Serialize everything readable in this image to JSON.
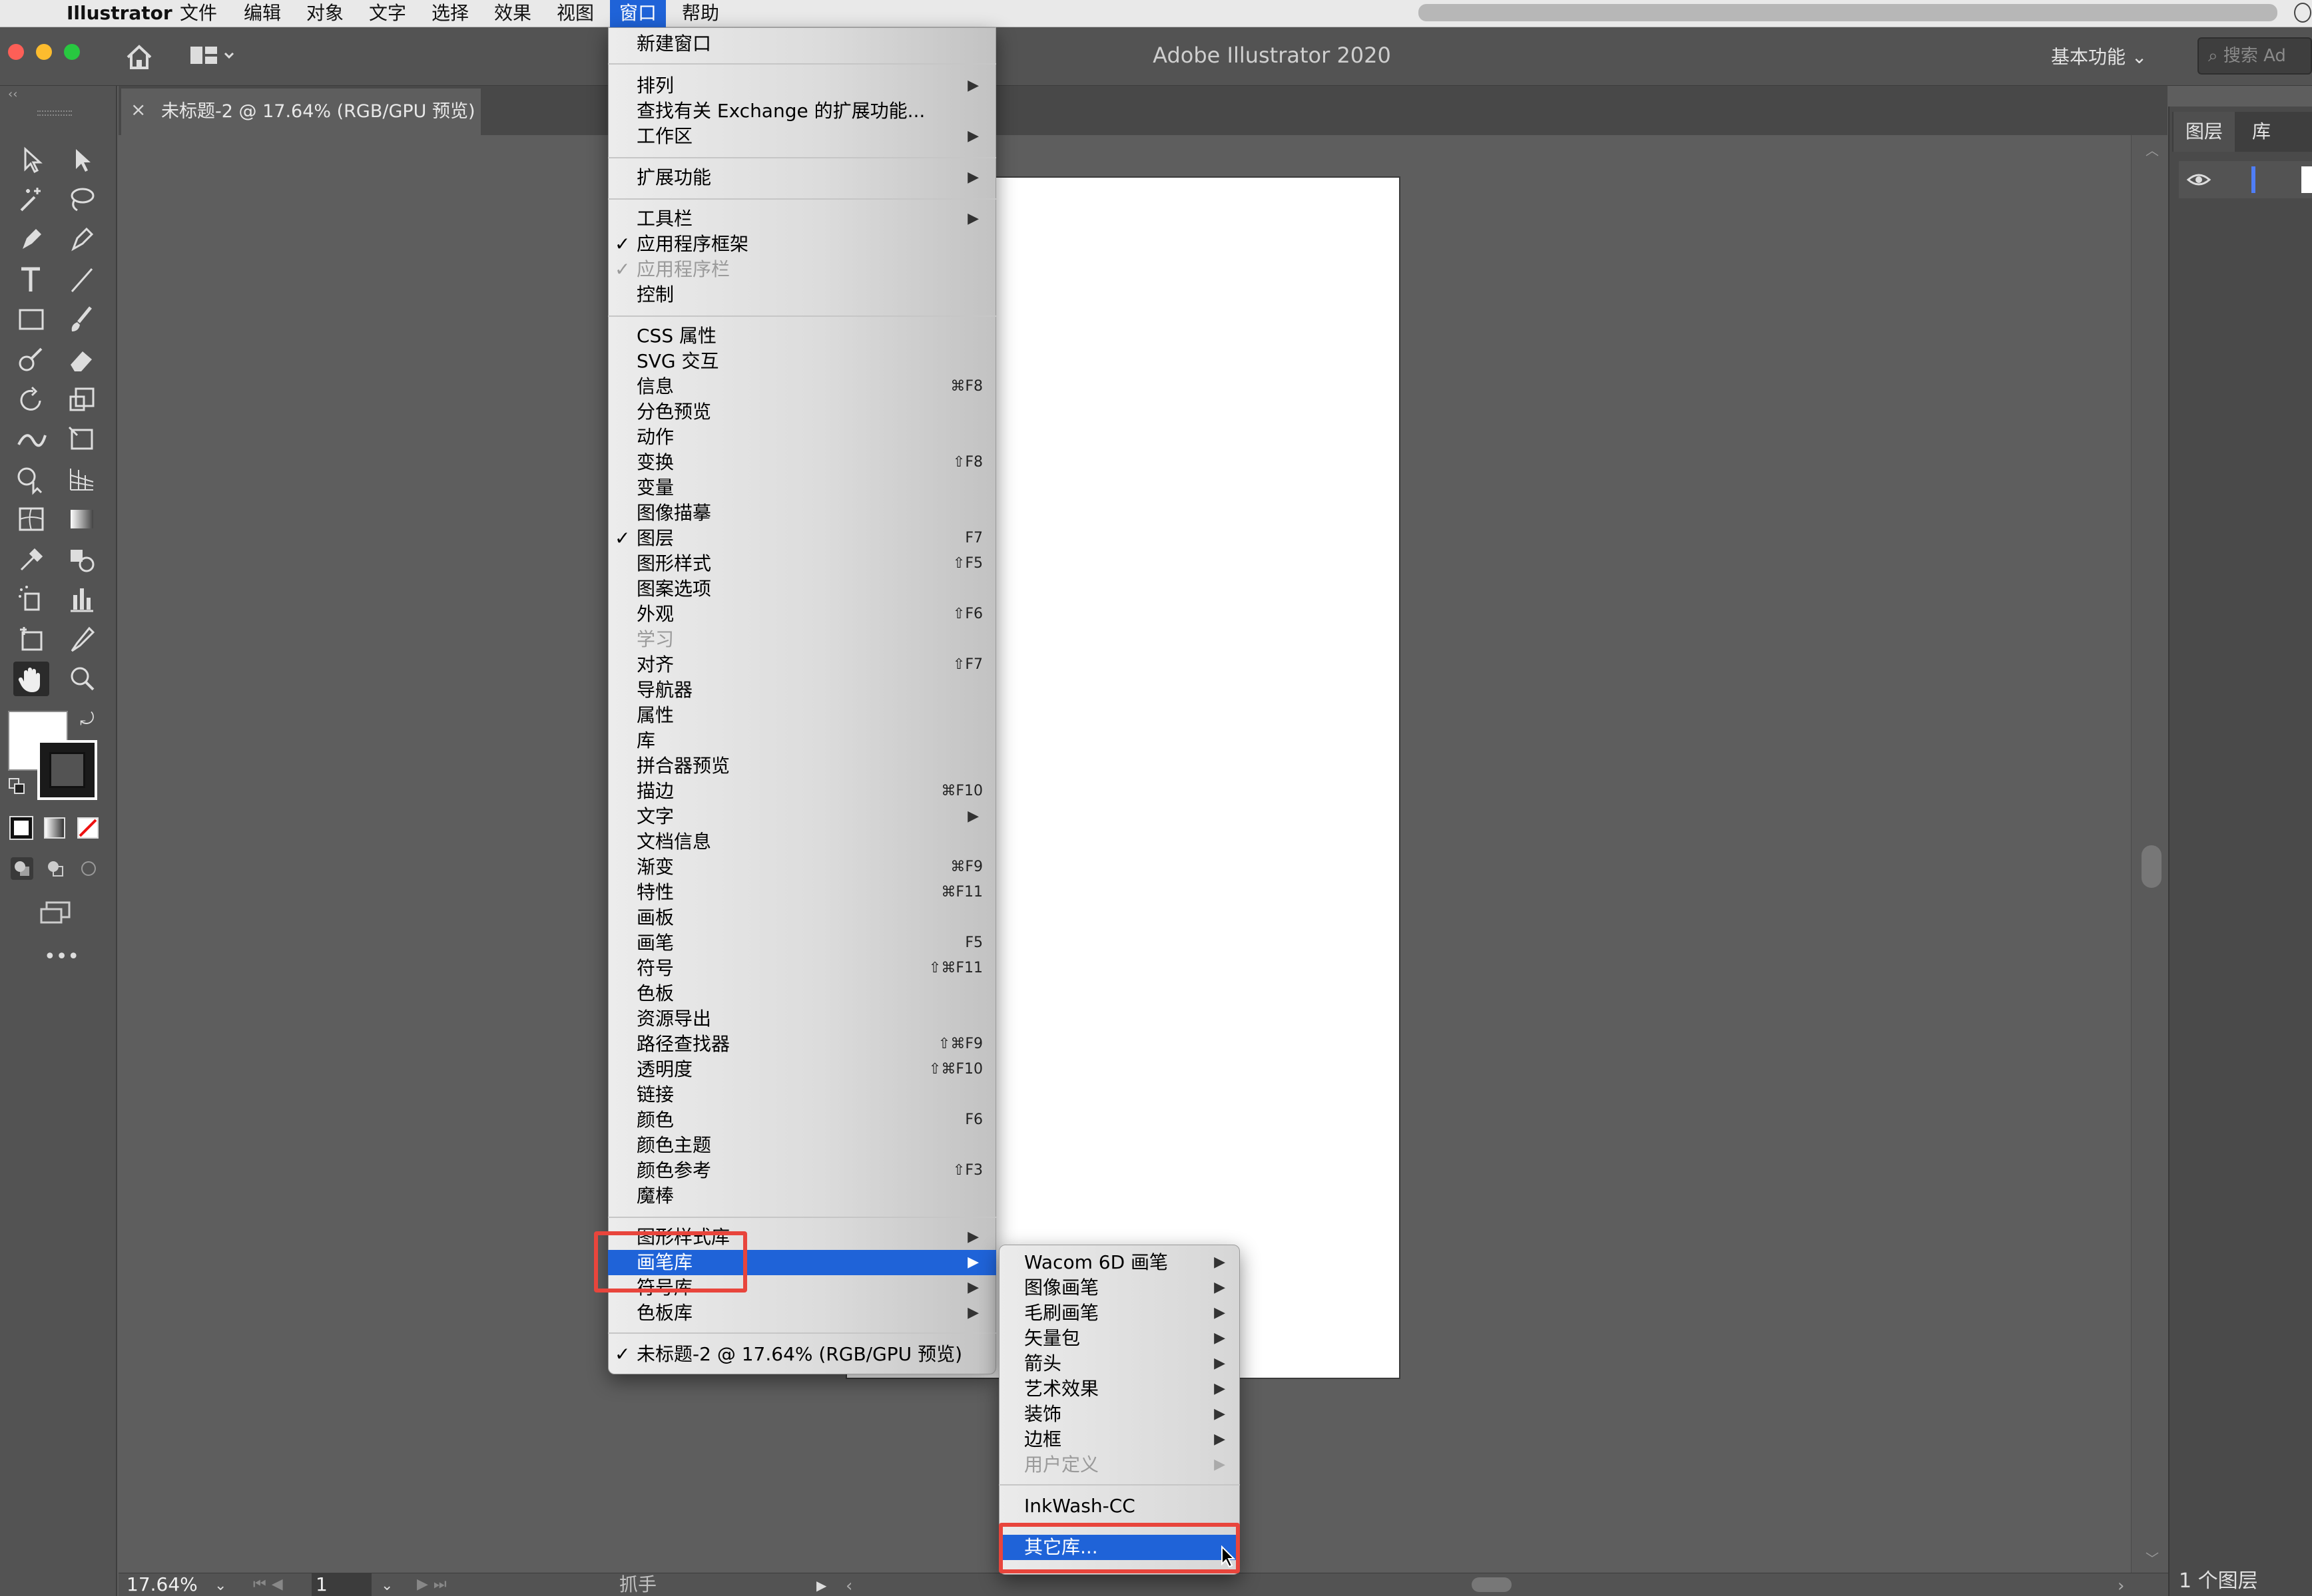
{
  "menubar": {
    "app_name": "Illustrator",
    "items": [
      "文件",
      "编辑",
      "对象",
      "文字",
      "选择",
      "效果",
      "视图",
      "窗口",
      "帮助"
    ],
    "active_item": "窗口"
  },
  "appbar": {
    "title": "Adobe Illustrator 2020",
    "workspace": "基本功能",
    "search_placeholder": "搜索 Ad"
  },
  "document_tab": {
    "title": "未标题-2 @ 17.64% (RGB/GPU 预览)",
    "close": "×"
  },
  "right_panel": {
    "tabs": [
      "图层",
      "库"
    ],
    "layers_count": "1 个图层",
    "eye": "👁"
  },
  "bottom_bar": {
    "zoom": "17.64%",
    "page": "1",
    "status": "抓手"
  },
  "window_menu": {
    "items": [
      {
        "label": "新建窗口"
      },
      {
        "label": "排列",
        "submenu": true
      },
      {
        "label": "查找有关 Exchange 的扩展功能..."
      },
      {
        "label": "工作区",
        "submenu": true
      },
      {
        "label": "扩展功能",
        "submenu": true
      },
      {
        "label": "工具栏",
        "submenu": true
      },
      {
        "label": "应用程序框架",
        "checked": true
      },
      {
        "label": "应用程序栏",
        "checked": true,
        "disabled": true
      },
      {
        "label": "控制"
      },
      {
        "label": "CSS 属性"
      },
      {
        "label": "SVG 交互"
      },
      {
        "label": "信息",
        "shortcut": "⌘F8"
      },
      {
        "label": "分色预览"
      },
      {
        "label": "动作"
      },
      {
        "label": "变换",
        "shortcut": "⇧F8"
      },
      {
        "label": "变量"
      },
      {
        "label": "图像描摹"
      },
      {
        "label": "图层",
        "checked": true,
        "shortcut": "F7"
      },
      {
        "label": "图形样式",
        "shortcut": "⇧F5"
      },
      {
        "label": "图案选项"
      },
      {
        "label": "外观",
        "shortcut": "⇧F6"
      },
      {
        "label": "学习",
        "disabled": true
      },
      {
        "label": "对齐",
        "shortcut": "⇧F7"
      },
      {
        "label": "导航器"
      },
      {
        "label": "属性"
      },
      {
        "label": "库"
      },
      {
        "label": "拼合器预览"
      },
      {
        "label": "描边",
        "shortcut": "⌘F10"
      },
      {
        "label": "文字",
        "submenu": true
      },
      {
        "label": "文档信息"
      },
      {
        "label": "渐变",
        "shortcut": "⌘F9"
      },
      {
        "label": "特性",
        "shortcut": "⌘F11"
      },
      {
        "label": "画板"
      },
      {
        "label": "画笔",
        "shortcut": "F5"
      },
      {
        "label": "符号",
        "shortcut": "⇧⌘F11"
      },
      {
        "label": "色板"
      },
      {
        "label": "资源导出"
      },
      {
        "label": "路径查找器",
        "shortcut": "⇧⌘F9"
      },
      {
        "label": "透明度",
        "shortcut": "⇧⌘F10"
      },
      {
        "label": "链接"
      },
      {
        "label": "颜色",
        "shortcut": "F6"
      },
      {
        "label": "颜色主题"
      },
      {
        "label": "颜色参考",
        "shortcut": "⇧F3"
      },
      {
        "label": "魔棒"
      },
      {
        "label": "图形样式库",
        "submenu": true
      },
      {
        "label": "画笔库",
        "submenu": true,
        "highlighted": true
      },
      {
        "label": "符号库",
        "submenu": true
      },
      {
        "label": "色板库",
        "submenu": true
      },
      {
        "label": "未标题-2 @ 17.64% (RGB/GPU 预览)",
        "checked": true
      }
    ],
    "check_mark": "✓",
    "arrow": "▶"
  },
  "brush_library_submenu": {
    "items": [
      {
        "label": "Wacom 6D 画笔",
        "submenu": true
      },
      {
        "label": "图像画笔",
        "submenu": true
      },
      {
        "label": "毛刷画笔",
        "submenu": true
      },
      {
        "label": "矢量包",
        "submenu": true
      },
      {
        "label": "箭头",
        "submenu": true
      },
      {
        "label": "艺术效果",
        "submenu": true
      },
      {
        "label": "装饰",
        "submenu": true
      },
      {
        "label": "边框",
        "submenu": true
      },
      {
        "label": "用户定义",
        "submenu": true,
        "disabled": true
      },
      {
        "label": "InkWash-CC"
      },
      {
        "label": "其它库...",
        "highlighted": true
      }
    ]
  },
  "colors": {
    "highlight": "#1f63d8",
    "annotation": "#e8453c"
  }
}
